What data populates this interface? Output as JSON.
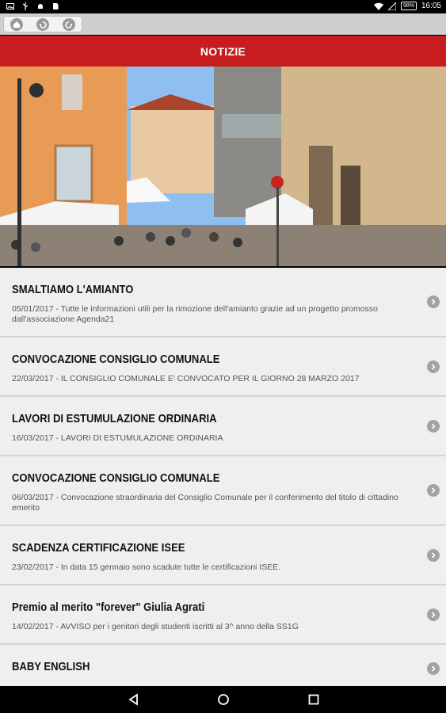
{
  "status_bar": {
    "battery": "98%",
    "time": "16:05",
    "icons": [
      "image-icon",
      "usb-icon",
      "android-debug-icon",
      "sd-card-icon",
      "wifi-icon",
      "signal-icon",
      "battery-icon"
    ]
  },
  "browser": {
    "buttons": [
      "home-icon",
      "back-icon",
      "forward-icon"
    ]
  },
  "header": {
    "title": "NOTIZIE"
  },
  "colors": {
    "brand_red": "#c81d1f",
    "list_bg": "#efefef",
    "status_bg": "#000000"
  },
  "news": [
    {
      "title": "SMALTIAMO L'AMIANTO",
      "desc": "05/01/2017 - Tutte le informazioni utili per la rimozione dell'amianto grazie ad un progetto promosso dall'associazione Agenda21"
    },
    {
      "title": "CONVOCAZIONE CONSIGLIO COMUNALE",
      "desc": "22/03/2017 - IL CONSIGLIO COMUNALE E' CONVOCATO PER IL GIORNO 28 MARZO 2017"
    },
    {
      "title": "LAVORI DI ESTUMULAZIONE ORDINARIA",
      "desc": "16/03/2017 - LAVORI DI ESTUMULAZIONE ORDINARIA"
    },
    {
      "title": "CONVOCAZIONE CONSIGLIO COMUNALE",
      "desc": "06/03/2017 - Convocazione straordinaria del Consiglio Comunale per il conferimento del titolo di cittadino emerito"
    },
    {
      "title": "SCADENZA CERTIFICAZIONE ISEE",
      "desc": "23/02/2017 - In data 15 gennaio sono scadute tutte le certificazioni ISEE."
    },
    {
      "title": "Premio al merito \"forever\" Giulia Agrati",
      "desc": "14/02/2017 - AVVISO per i genitori degli studenti iscritti al 3^ anno della SS1G"
    },
    {
      "title": "BABY ENGLISH",
      "desc": ""
    }
  ],
  "nav_bar": {
    "buttons": [
      "back-triangle-icon",
      "home-circle-icon",
      "recents-square-icon"
    ]
  }
}
